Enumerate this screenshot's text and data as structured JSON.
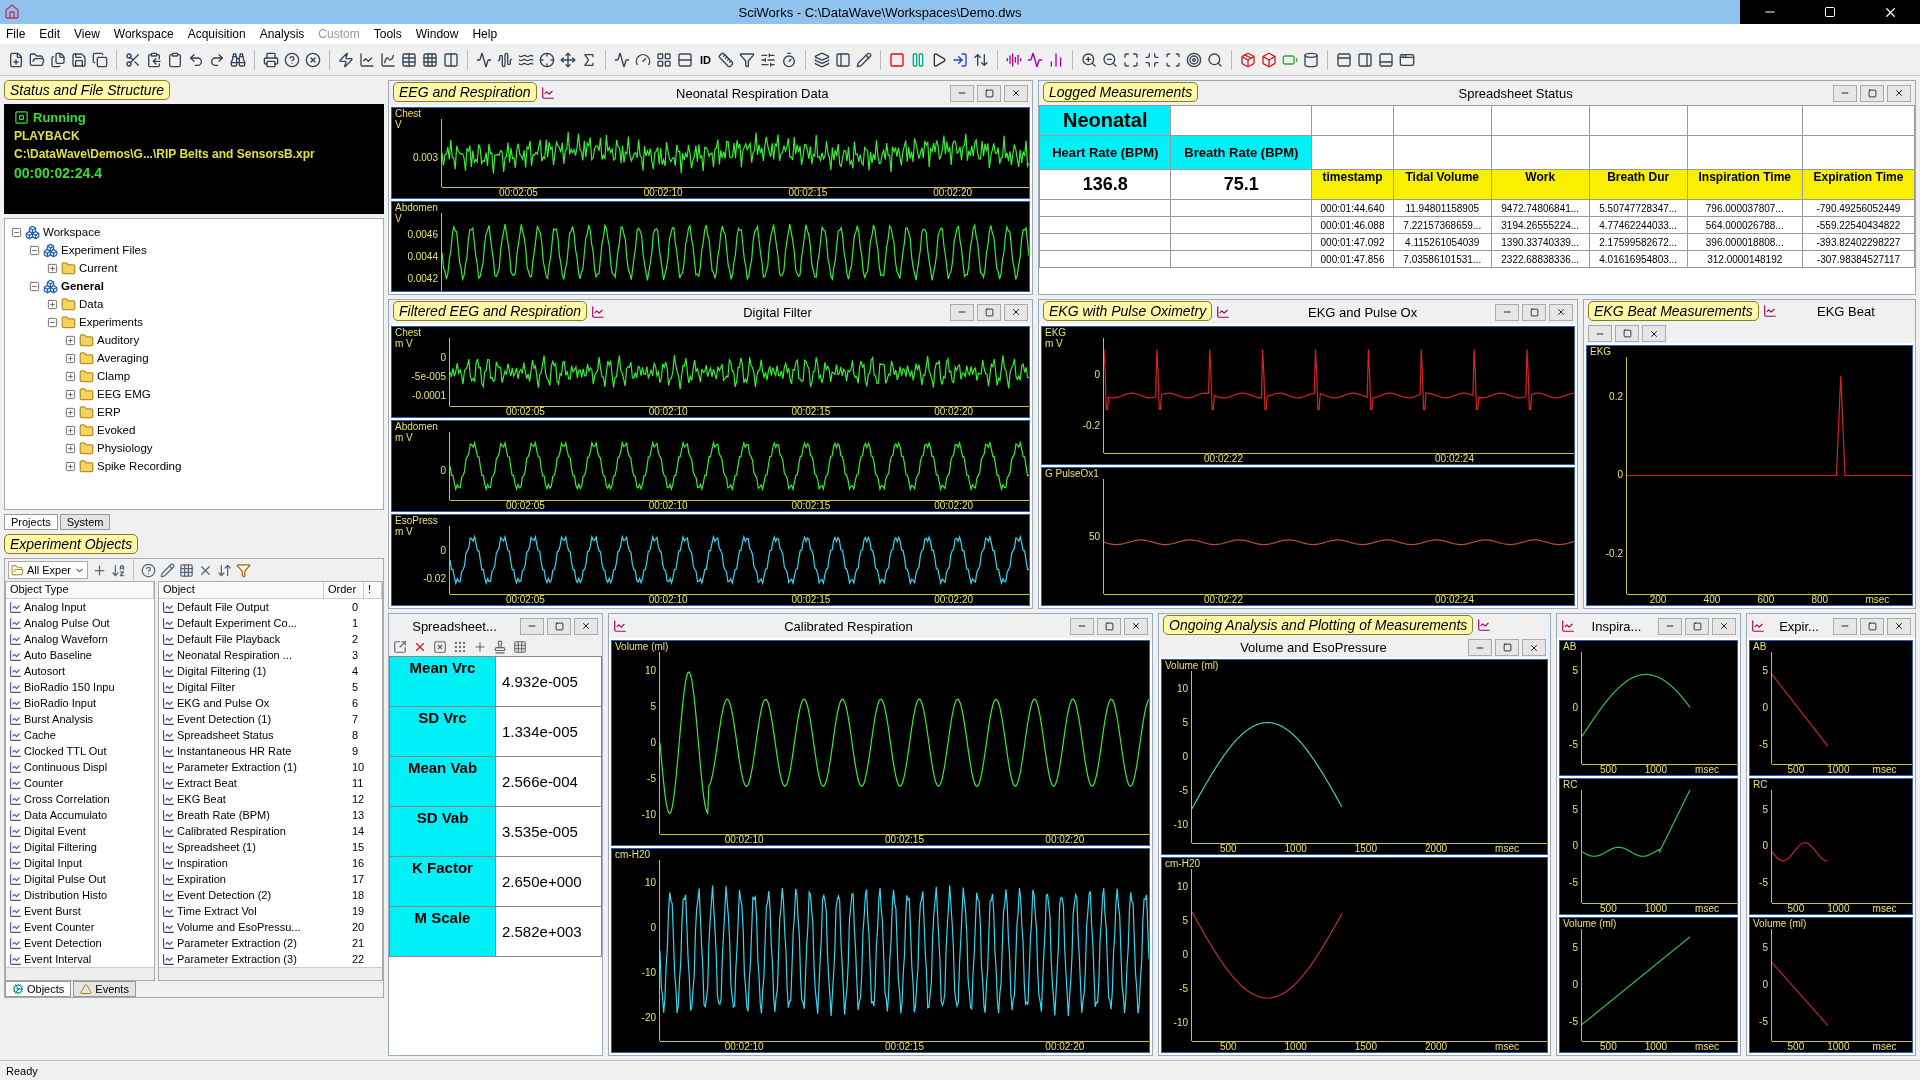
{
  "window": {
    "title": "SciWorks - C:\\DataWave\\Workspaces\\Demo.dws"
  },
  "menu": [
    {
      "label": "File",
      "disabled": false
    },
    {
      "label": "Edit",
      "disabled": false
    },
    {
      "label": "View",
      "disabled": false
    },
    {
      "label": "Workspace",
      "disabled": false
    },
    {
      "label": "Acquisition",
      "disabled": false
    },
    {
      "label": "Analysis",
      "disabled": false
    },
    {
      "label": "Custom",
      "disabled": true
    },
    {
      "label": "Tools",
      "disabled": false
    },
    {
      "label": "Window",
      "disabled": false
    },
    {
      "label": "Help",
      "disabled": false
    }
  ],
  "toolbar": {
    "id_button": "ID"
  },
  "status_panel": {
    "callout": "Status and File Structure",
    "state": "Running",
    "mode": "PLAYBACK",
    "file": "C:\\DataWave\\Demos\\G...\\RIP Belts and SensorsB.xpr",
    "time": "00:00:02:24.4"
  },
  "tree": [
    {
      "label": "Workspace",
      "expanded": true,
      "active": false,
      "kind": "group",
      "children": [
        {
          "label": "Experiment Files",
          "expanded": true,
          "active": false,
          "kind": "group",
          "children": [
            {
              "label": "Current",
              "expanded": false,
              "active": false,
              "kind": "folder"
            }
          ]
        },
        {
          "label": "General",
          "expanded": true,
          "active": true,
          "kind": "group",
          "children": [
            {
              "label": "Data",
              "expanded": false,
              "active": false,
              "kind": "folder"
            },
            {
              "label": "Experiments",
              "expanded": true,
              "active": false,
              "kind": "folder",
              "children": [
                {
                  "label": "Auditory",
                  "expanded": false,
                  "active": false,
                  "kind": "folder"
                },
                {
                  "label": "Averaging",
                  "expanded": false,
                  "active": false,
                  "kind": "folder"
                },
                {
                  "label": "Clamp",
                  "expanded": false,
                  "active": false,
                  "kind": "folder"
                },
                {
                  "label": "EEG EMG",
                  "expanded": false,
                  "active": false,
                  "kind": "folder"
                },
                {
                  "label": "ERP",
                  "expanded": false,
                  "active": false,
                  "kind": "folder"
                },
                {
                  "label": "Evoked",
                  "expanded": false,
                  "active": false,
                  "kind": "folder"
                },
                {
                  "label": "Physiology",
                  "expanded": false,
                  "active": false,
                  "kind": "folder"
                },
                {
                  "label": "Spike Recording",
                  "expanded": false,
                  "active": false,
                  "kind": "folder"
                }
              ]
            }
          ]
        }
      ]
    }
  ],
  "tree_tabs": [
    {
      "label": "Projects",
      "selected": true
    },
    {
      "label": "System",
      "selected": false
    }
  ],
  "objects": {
    "callout": "Experiment Objects",
    "filter": "All Exper",
    "type_header": "Object Type",
    "object_header": "Object",
    "order_header": "Order",
    "extra_header": "!",
    "types": [
      "Analog Input",
      "Analog Pulse Out",
      "Analog Waveforn",
      "Auto Baseline",
      "Autosort",
      "BioRadio 150 Inpu",
      "BioRadio Input",
      "Burst Analysis",
      "Cache",
      "Clocked TTL Out",
      "Continuous Displ",
      "Counter",
      "Cross Correlation",
      "Data Accumulato",
      "Digital Event",
      "Digital Filtering",
      "Digital Input",
      "Digital Pulse Out",
      "Distribution Histo",
      "Event Burst",
      "Event Counter",
      "Event Detection",
      "Event Interval"
    ],
    "items": [
      {
        "name": "Default File Output",
        "order": "0"
      },
      {
        "name": "Default Experiment Co...",
        "order": "1"
      },
      {
        "name": "Default File Playback",
        "order": "2"
      },
      {
        "name": "Neonatal Respiration ...",
        "order": "3"
      },
      {
        "name": "Digital Filtering (1)",
        "order": "4"
      },
      {
        "name": "Digital Filter",
        "order": "5"
      },
      {
        "name": "EKG and Pulse Ox",
        "order": "6"
      },
      {
        "name": "Event Detection (1)",
        "order": "7"
      },
      {
        "name": "Spreadsheet Status",
        "order": "8"
      },
      {
        "name": "Instantaneous HR Rate",
        "order": "9"
      },
      {
        "name": "Parameter Extraction (1)",
        "order": "10"
      },
      {
        "name": "Extract Beat",
        "order": "11"
      },
      {
        "name": "EKG Beat",
        "order": "12"
      },
      {
        "name": "Breath Rate (BPM)",
        "order": "13"
      },
      {
        "name": "Calibrated Respiration",
        "order": "14"
      },
      {
        "name": "Spreadsheet (1)",
        "order": "15"
      },
      {
        "name": "Inspiration",
        "order": "16"
      },
      {
        "name": "Expiration",
        "order": "17"
      },
      {
        "name": "Event Detection (2)",
        "order": "18"
      },
      {
        "name": "Time Extract Vol",
        "order": "19"
      },
      {
        "name": "Volume and EsoPressu...",
        "order": "20"
      },
      {
        "name": "Parameter Extraction (2)",
        "order": "21"
      },
      {
        "name": "Parameter Extraction (3)",
        "order": "22"
      }
    ],
    "tabs": [
      {
        "label": "Objects",
        "selected": true
      },
      {
        "label": "Events",
        "selected": false
      }
    ]
  },
  "eeg_window": {
    "callout": "EEG and Respiration",
    "title": "Neonatal Respiration Data",
    "channels": [
      {
        "label": "Chest",
        "unit": "V",
        "yticks": [
          "0.003"
        ],
        "xticks": [
          "00:02:05",
          "00:02:10",
          "00:02:15",
          "00:02:20"
        ],
        "color": "#33ee33",
        "kind": "noise"
      },
      {
        "label": "Abdomen",
        "unit": "V",
        "yticks": [
          "0.0046",
          "0.0044",
          "0.0042"
        ],
        "color": "#33ee33",
        "kind": "fast-sine"
      }
    ]
  },
  "filter_window": {
    "callout": "Filtered EEG and Respiration",
    "title": "Digital Filter",
    "channels": [
      {
        "label": "Chest",
        "unit": "m V",
        "yticks": [
          "0",
          "-5e-005",
          "-0.0001"
        ],
        "xticks": [
          "00:02:05",
          "00:02:10",
          "00:02:15",
          "00:02:20"
        ],
        "color": "#33ee33",
        "kind": "eeg"
      },
      {
        "label": "Abdomen",
        "unit": "m V",
        "yticks": [
          "0"
        ],
        "xticks": [
          "00:02:05",
          "00:02:10",
          "00:02:15",
          "00:02:20"
        ],
        "color": "#33ee33",
        "kind": "sine"
      },
      {
        "label": "EsoPress",
        "unit": "m V",
        "yticks": [
          "0",
          "-0.02"
        ],
        "xticks": [
          "00:02:05",
          "00:02:10",
          "00:02:15",
          "00:02:20"
        ],
        "color": "#30d8f0",
        "kind": "sine"
      }
    ]
  },
  "spreadsheet_status": {
    "callout": "Logged Measurements",
    "title": "Spreadsheet Status",
    "name": "Neonatal",
    "rate_headers": [
      "Heart Rate (BPM)",
      "Breath Rate (BPM)"
    ],
    "rates": [
      "136.8",
      "75.1"
    ],
    "columns": [
      "timestamp",
      "Tidal Volume",
      "Work",
      "Breath Dur",
      "Inspiration Time",
      "Expiration Time"
    ],
    "rows": [
      [
        "000:01:44.640",
        "11.94801158905",
        "9472.74806841...",
        "5.50747728347...",
        "796.000037807...",
        "-790.49256052449"
      ],
      [
        "000:01:46.088",
        "7.22157368659...",
        "3194.26555224...",
        "4.77462244033...",
        "564.000026788...",
        "-559.22540434822"
      ],
      [
        "000:01:47.092",
        "4.115261054039",
        "1390.33740339...",
        "2.17599582672...",
        "396.000018808...",
        "-393.82402298227"
      ],
      [
        "000:01:47.856",
        "7.03586101531...",
        "2322.68838336...",
        "4.01616954803...",
        "312.0000148192",
        "-307.98384527117"
      ]
    ]
  },
  "ekg_window": {
    "callout": "EKG with Pulse Oximetry",
    "title": "EKG and Pulse Ox",
    "channels": [
      {
        "label": "EKG",
        "unit": "m V",
        "yticks": [
          "0",
          "-0.2"
        ],
        "xticks": [
          "00:02:22",
          "00:02:24"
        ],
        "color": "#d42424",
        "kind": "ekg"
      },
      {
        "label": "G PulseOx1",
        "yticks": [
          "50"
        ],
        "xticks": [
          "00:02:22",
          "00:02:24"
        ],
        "color": "#b8502a",
        "kind": "flat"
      }
    ]
  },
  "beat_window": {
    "callout": "EKG Beat Measurements",
    "title": "EKG Beat",
    "channels": [
      {
        "label": "EKG",
        "yticks": [
          "0.2",
          "0",
          "-0.2"
        ],
        "xticks": [
          "200",
          "400",
          "600",
          "800"
        ],
        "xlabel": "msec",
        "color": "#d42424",
        "kind": "beat"
      }
    ]
  },
  "small_sheet": {
    "title": "Spreadsheet...",
    "rows": [
      {
        "label": "Mean Vrc",
        "value": "4.932e-005"
      },
      {
        "label": "SD Vrc",
        "value": "1.334e-005"
      },
      {
        "label": "Mean Vab",
        "value": "2.566e-004"
      },
      {
        "label": "SD Vab",
        "value": "3.535e-005"
      },
      {
        "label": "K Factor",
        "value": "2.650e+000"
      },
      {
        "label": "M Scale",
        "value": "2.582e+003"
      }
    ]
  },
  "calibrated_window": {
    "title": "Calibrated Respiration",
    "channels": [
      {
        "label": "Volume (ml)",
        "yticks": [
          "10",
          "5",
          "0",
          "-5",
          "-10"
        ],
        "xticks": [
          "00:02:10",
          "00:02:15",
          "00:02:20"
        ],
        "color": "#33ee33",
        "kind": "damped"
      },
      {
        "label": "cm-H20",
        "yticks": [
          "10",
          "0",
          "-10",
          "-20"
        ],
        "xticks": [
          "00:02:10",
          "00:02:15",
          "00:02:20"
        ],
        "color": "#30d8f0",
        "kind": "fast-sine"
      }
    ]
  },
  "volume_window": {
    "callout": "Ongoing Analysis and Plotting of Measurements",
    "title": "Volume and EsoPressure",
    "channels": [
      {
        "label": "Volume (ml)",
        "yticks": [
          "10",
          "5",
          "0",
          "-5",
          "-10"
        ],
        "xticks": [
          "500",
          "1000",
          "1500",
          "2000"
        ],
        "xlabel": "msec",
        "color": "#40d0c0",
        "kind": "hump"
      },
      {
        "label": "cm-H20",
        "yticks": [
          "10",
          "5",
          "0",
          "-5",
          "-10"
        ],
        "xticks": [
          "500",
          "1000",
          "1500",
          "2000"
        ],
        "xlabel": "msec",
        "color": "#c03030",
        "kind": "dip"
      }
    ]
  },
  "inspiration_window": {
    "title": "Inspira...",
    "channels": [
      {
        "label": "AB",
        "yticks": [
          "5",
          "0",
          "-5"
        ],
        "xticks": [
          "500",
          "1000"
        ],
        "xlabel": "msec",
        "color": "#2ec050",
        "kind": "arch"
      },
      {
        "label": "RC",
        "yticks": [
          "5",
          "0",
          "-5"
        ],
        "xticks": [
          "500",
          "1000"
        ],
        "xlabel": "msec",
        "color": "#2ec050",
        "kind": "valley"
      },
      {
        "label": "Volume (ml)",
        "yticks": [
          "5",
          "0",
          "-5"
        ],
        "xticks": [
          "500",
          "1000"
        ],
        "xlabel": "msec",
        "color": "#2ec050",
        "kind": "ramp"
      }
    ]
  },
  "expiration_window": {
    "title": "Expir...",
    "channels": [
      {
        "label": "AB",
        "yticks": [
          "5",
          "0",
          "-5"
        ],
        "xticks": [
          "500",
          "1000"
        ],
        "xlabel": "msec",
        "color": "#c02828",
        "kind": "drop"
      },
      {
        "label": "RC",
        "yticks": [
          "5",
          "0",
          "-5"
        ],
        "xticks": [
          "500",
          "1000"
        ],
        "xlabel": "msec",
        "color": "#c02828",
        "kind": "wobble"
      },
      {
        "label": "Volume (ml)",
        "yticks": [
          "5",
          "0",
          "-5"
        ],
        "xticks": [
          "500",
          "1000"
        ],
        "xlabel": "msec",
        "color": "#c02828",
        "kind": "slide"
      }
    ]
  },
  "status_bar": {
    "text": "Ready"
  }
}
